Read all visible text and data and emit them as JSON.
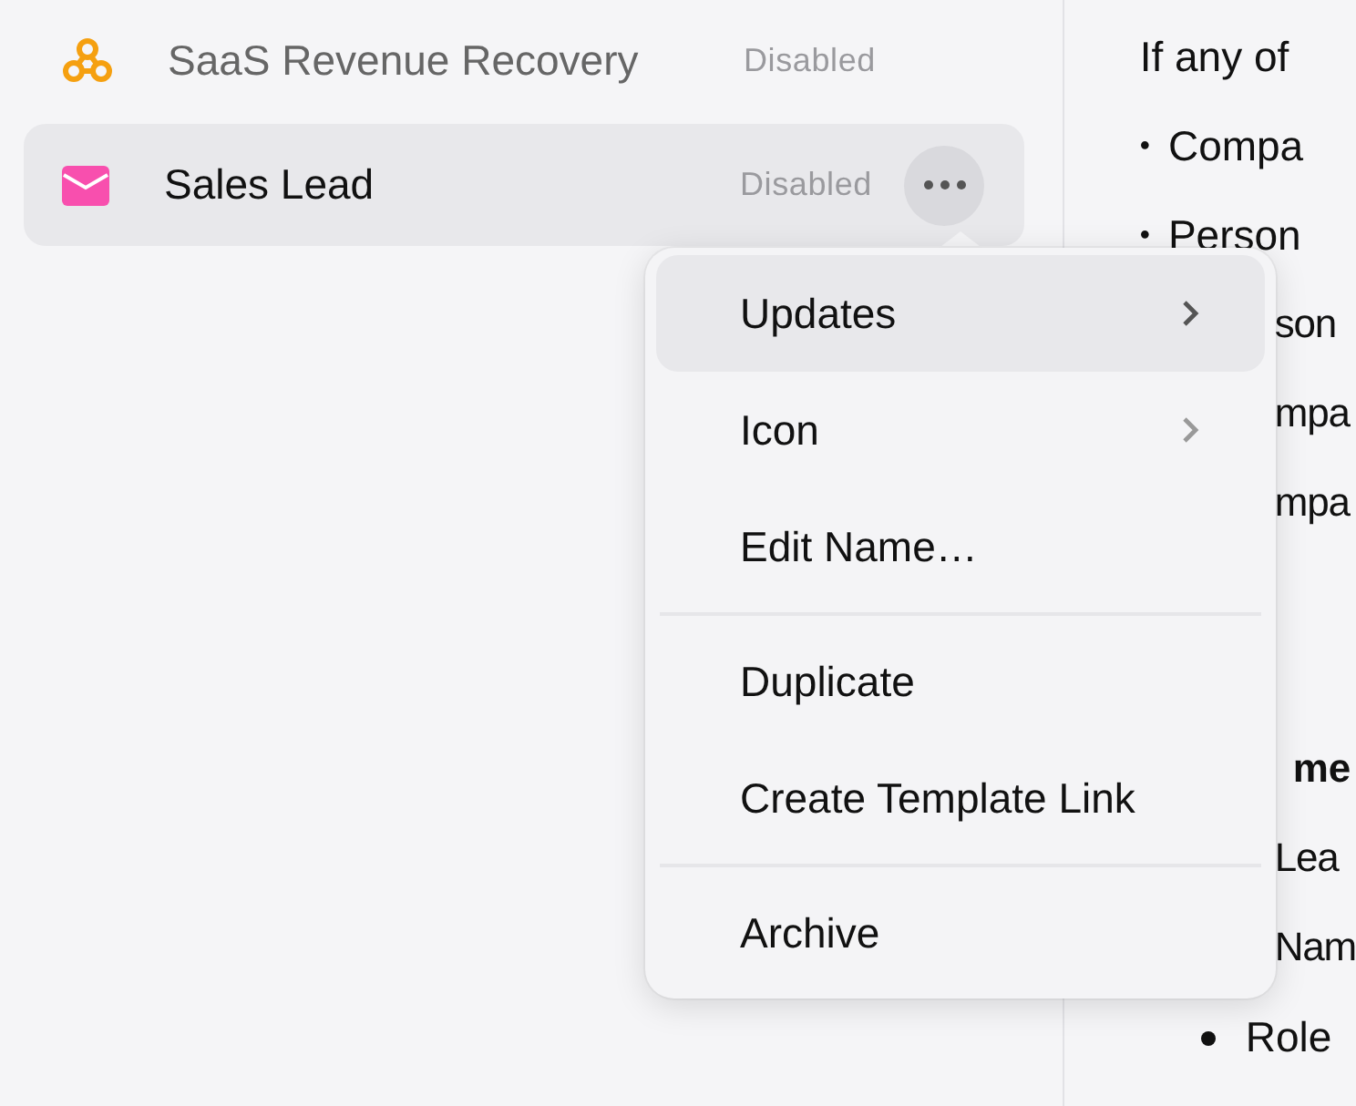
{
  "sidebar": {
    "items": [
      {
        "name": "SaaS Revenue Recovery",
        "status": "Disabled",
        "selected": false,
        "color": "#f5a010"
      },
      {
        "name": "Sales Lead",
        "status": "Disabled",
        "selected": true,
        "color": "#f84fae"
      }
    ]
  },
  "context_menu": {
    "groups": [
      [
        {
          "label": "Updates",
          "submenu": true,
          "selected": true
        },
        {
          "label": "Icon",
          "submenu": true,
          "selected": false
        },
        {
          "label": "Edit Name…",
          "submenu": false,
          "selected": false
        }
      ],
      [
        {
          "label": "Duplicate",
          "submenu": false,
          "selected": false
        },
        {
          "label": "Create Template Link",
          "submenu": false,
          "selected": false
        }
      ],
      [
        {
          "label": "Archive",
          "submenu": false,
          "selected": false
        }
      ]
    ]
  },
  "content": {
    "lines": [
      {
        "kind": "text",
        "text": "If any of"
      },
      {
        "kind": "bullet",
        "bullet": "•",
        "text": "Compa"
      },
      {
        "kind": "bullet",
        "bullet": "•",
        "text": "Person"
      },
      {
        "kind": "clipped",
        "text": "son"
      },
      {
        "kind": "clipped",
        "text": "mpa"
      },
      {
        "kind": "clipped",
        "text": "mpa"
      },
      {
        "kind": "gap"
      },
      {
        "kind": "clipped-strong",
        "text": "me"
      },
      {
        "kind": "clipped",
        "text": "Lea"
      },
      {
        "kind": "clipped",
        "text": "Nam"
      },
      {
        "kind": "sub-bullet",
        "text": "Role"
      }
    ]
  }
}
